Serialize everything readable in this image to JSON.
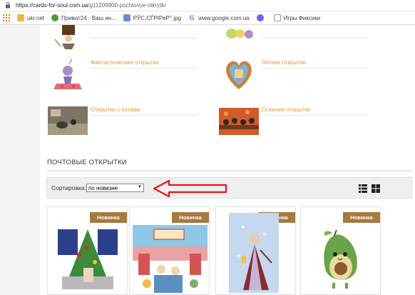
{
  "browser": {
    "url_host": "https://cards-for-soul.com.ua",
    "url_path": "/g11209900-pochtovye-otkrytki",
    "bookmarks": [
      {
        "label": "",
        "icon": "apps-icon",
        "color": "#e37400"
      },
      {
        "label": "ukr.net",
        "icon": "folder-icon",
        "color": "#f3b33b"
      },
      {
        "label": "Приват24 - Ваш ин...",
        "icon": "privat24-icon",
        "color": "#4f9a36"
      },
      {
        "label": "PЎС,СЃPIPeP°.jpg",
        "icon": "file-icon",
        "color": "#6b8fd6"
      },
      {
        "label": "www.google.com.ua",
        "icon": "google-icon",
        "color": "#4285f4"
      },
      {
        "label": "",
        "icon": "viber-icon",
        "color": "#7360f2"
      },
      {
        "label": "Игры Фиксики",
        "icon": "page-icon",
        "color": "#888"
      }
    ]
  },
  "categories": [
    {
      "label": "Фантастические открытки"
    },
    {
      "label": "Летние открытки"
    },
    {
      "label": "Открытки с котами"
    },
    {
      "label": "Осенние открытки"
    }
  ],
  "section": {
    "title": "ПОЧТОВЫЕ ОТКРЫТКИ"
  },
  "sort": {
    "label": "Сортировка:",
    "value": "по новизне",
    "options": [
      "по новизне"
    ]
  },
  "products": [
    {
      "badge": "Новинка"
    },
    {
      "badge": "Новинка"
    },
    {
      "badge": "Новинка"
    },
    {
      "badge": "Новинка"
    }
  ],
  "colors": {
    "accent": "#e8973a",
    "badge": "#a57a3f",
    "arrow": "#e0161d"
  }
}
